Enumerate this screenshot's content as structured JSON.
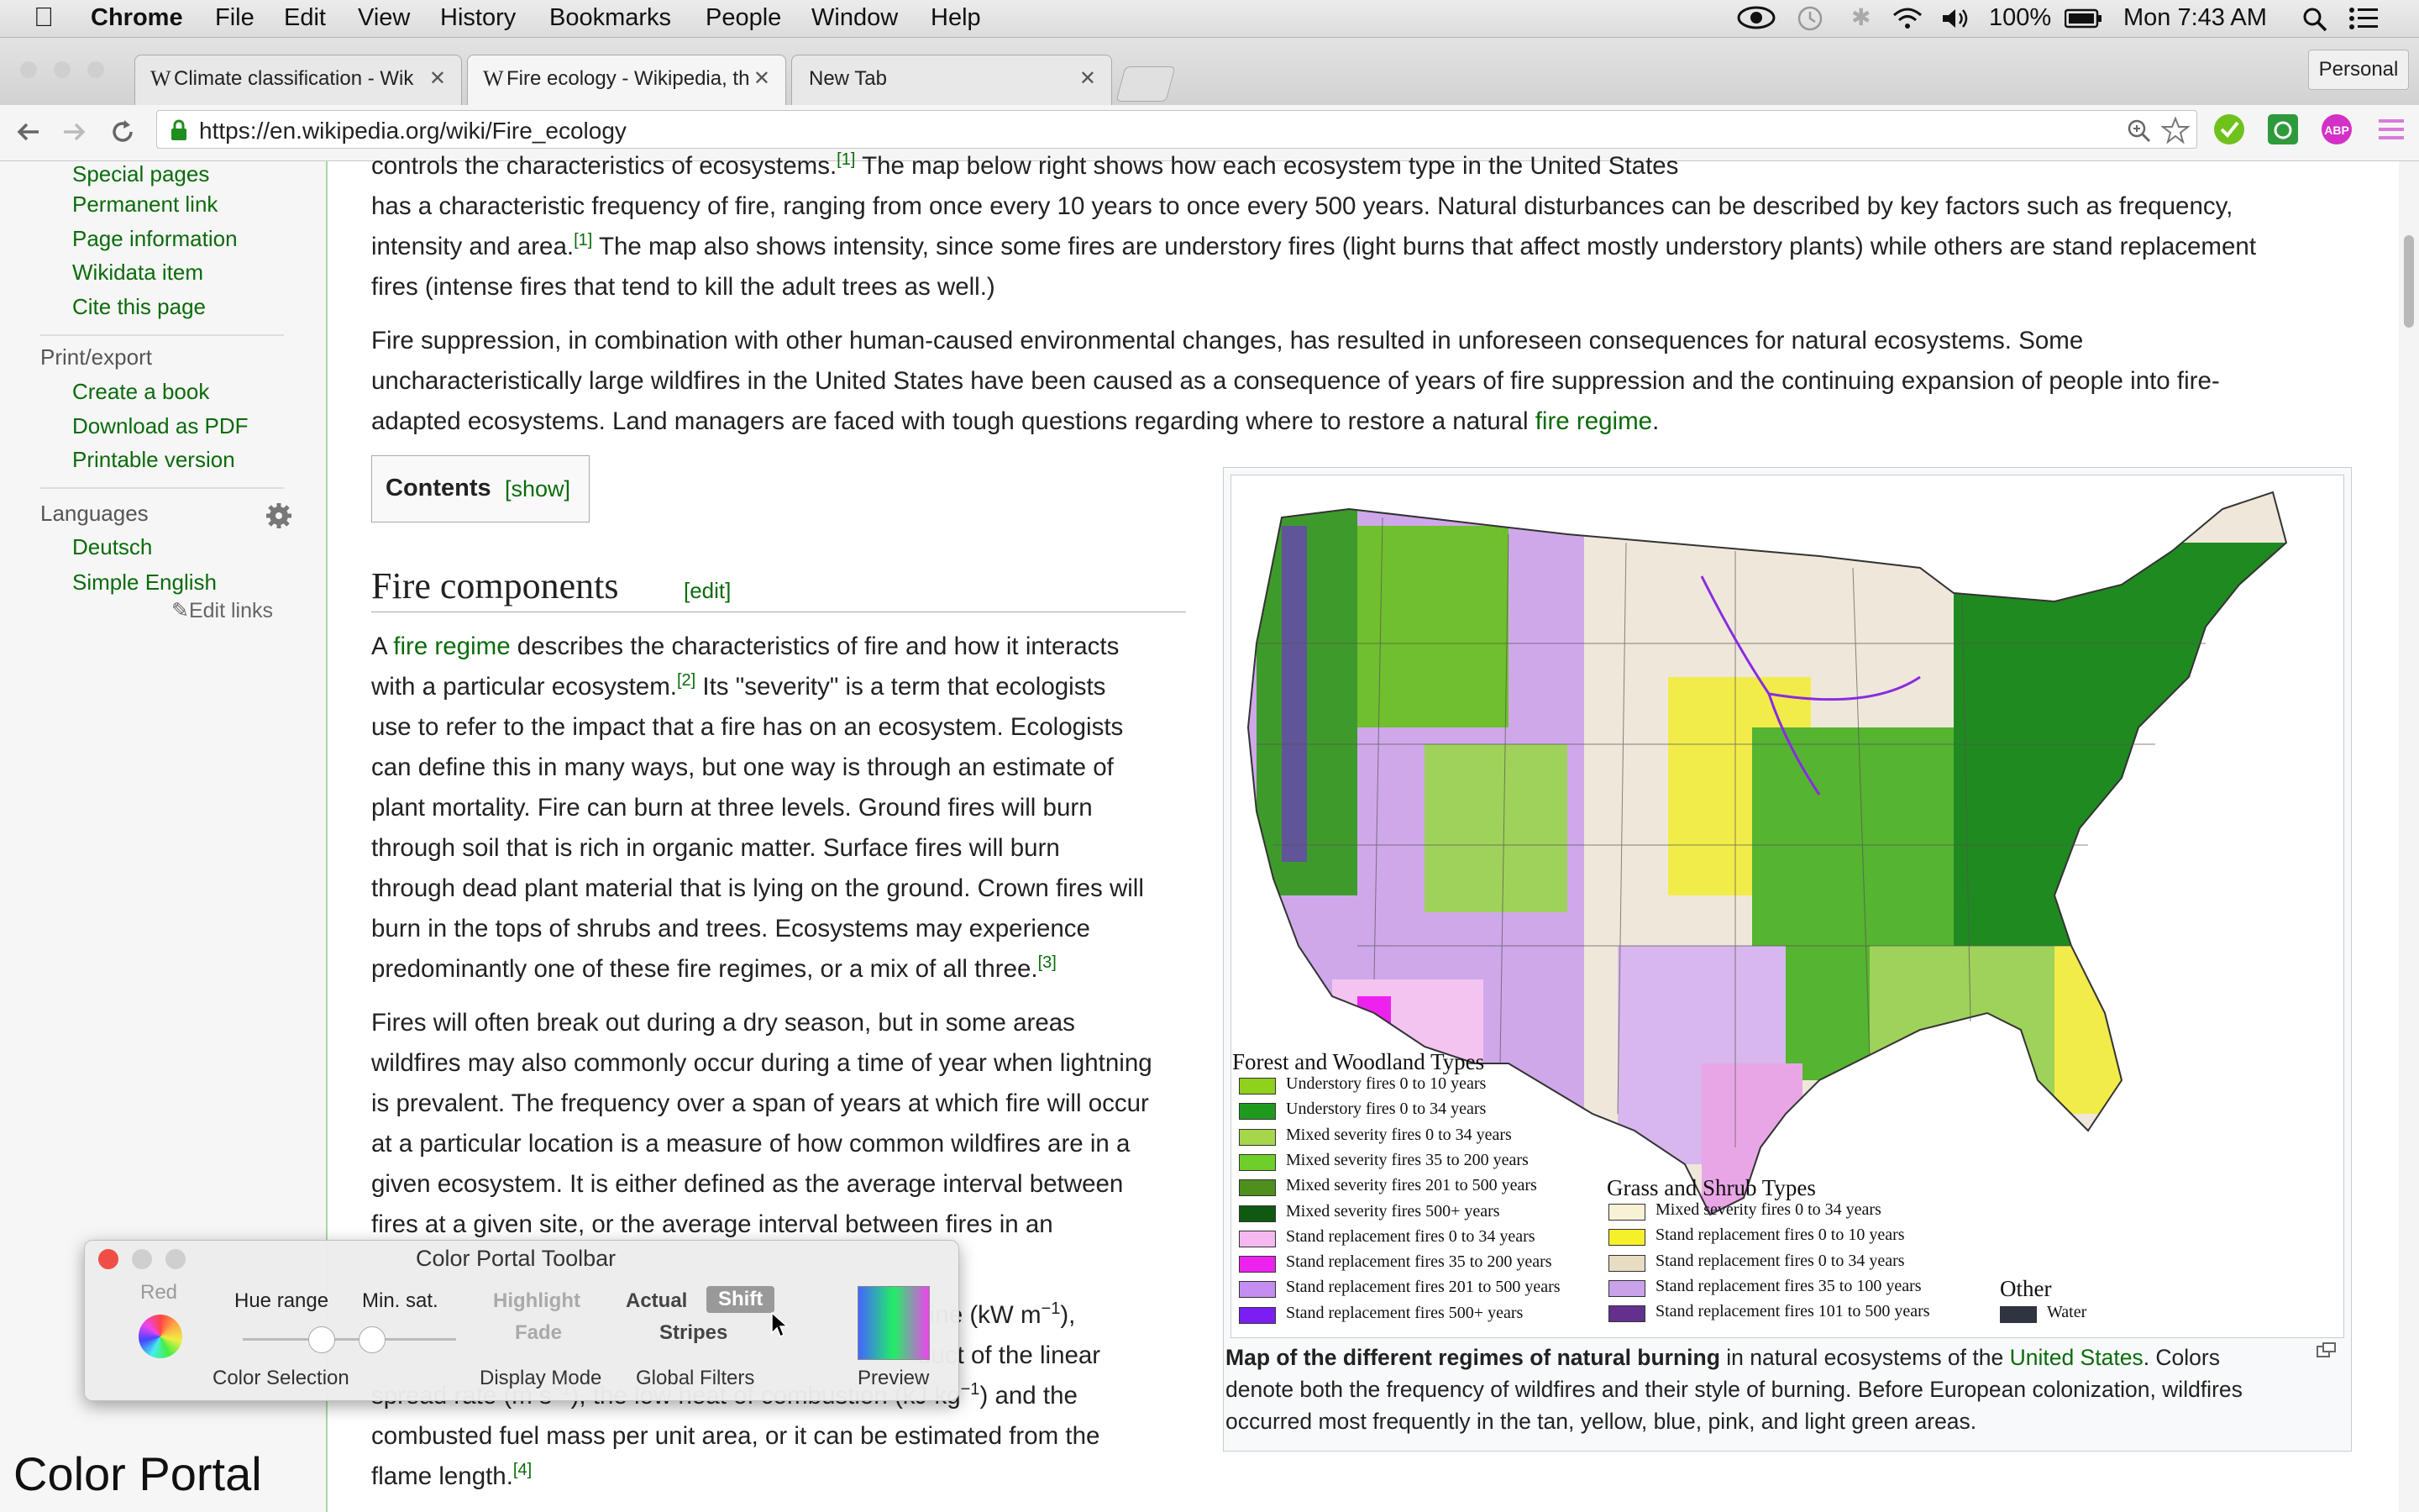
{
  "menubar": {
    "app": "Chrome",
    "items": [
      "File",
      "Edit",
      "View",
      "History",
      "Bookmarks",
      "People",
      "Window",
      "Help"
    ],
    "battery": "100%",
    "clock": "Mon 7:43 AM"
  },
  "tabs": [
    {
      "label": "Climate classification - Wik",
      "favicon": "W"
    },
    {
      "label": "Fire ecology - Wikipedia, th",
      "favicon": "W"
    },
    {
      "label": "New Tab",
      "favicon": ""
    }
  ],
  "profile": "Personal",
  "url": "https://en.wikipedia.org/wiki/Fire_ecology",
  "sidebar": {
    "tools": [
      "Special pages",
      "Permanent link",
      "Page information",
      "Wikidata item",
      "Cite this page"
    ],
    "print_heading": "Print/export",
    "print": [
      "Create a book",
      "Download as PDF",
      "Printable version"
    ],
    "lang_heading": "Languages",
    "languages": [
      "Deutsch",
      "Simple English"
    ],
    "edit_links": "Edit links"
  },
  "article": {
    "p0_line0": "controls the characteristics of ecosystems.",
    "p0_ref0": "[1]",
    "p0_line0b": " The map below right shows how each ecosystem type in the United States",
    "p0_line1": "has a characteristic frequency of fire, ranging from once every 10 years to once every 500 years. Natural disturbances can be described by key factors such as frequency,",
    "p0_line2a": "intensity and area.",
    "p0_ref1": "[1]",
    "p0_line2b": " The map also shows intensity, since some fires are understory fires (light burns that affect mostly understory plants) while others are stand replacement",
    "p0_line3": "fires (intense fires that tend to kill the adult trees as well.)",
    "p1_line0": "Fire suppression, in combination with other human-caused environmental changes, has resulted in unforeseen consequences for natural ecosystems. Some",
    "p1_line1": "uncharacteristically large wildfires in the United States have been caused as a consequence of years of fire suppression and the continuing expansion of people into fire-",
    "p1_line2a": "adapted ecosystems. Land managers are faced with tough questions regarding where to restore a natural ",
    "p1_link": "fire regime",
    "p1_line2b": ".",
    "toc_title": "Contents",
    "toc_show": "[show]",
    "section_title": "Fire components",
    "section_edit": "[edit]",
    "p2_a": "A ",
    "p2_link": "fire regime",
    "p2_lines": [
      " describes the characteristics of fire and how it interacts",
      "with a particular ecosystem.",
      "use to refer to the impact that a fire has on an ecosystem. Ecologists",
      "can define this in many ways, but one way is through an estimate of",
      "plant mortality. Fire can burn at three levels. Ground fires will burn",
      "through soil that is rich in organic matter. Surface fires will burn",
      "through dead plant material that is lying on the ground. Crown fires will",
      "burn in the tops of shrubs and trees. Ecosystems may experience",
      "predominantly one of these fire regimes, or a mix of all three."
    ],
    "p2_ref2": "[2]",
    "p2_line1b": " Its \"severity\" is a term that ecologists",
    "p2_ref3": "[3]",
    "p3_lines": [
      "Fires will often break out during a dry season, but in some areas",
      "wildfires may also commonly occur during a time of year when lightning",
      "is prevalent. The frequency over a span of years at which fire will occur",
      "at a particular location is a measure of how common wildfires are in a",
      "given ecosystem. It is either defined as the average interval between",
      "fires at a given site, or the average interval between fires in an"
    ],
    "p4_l0": "reline (kW m",
    "p4_l0_sup": "−1",
    "p4_l0_end": "),",
    "p4_l1": "duct of the linear",
    "p4_l2": "spread rate (m s",
    "p4_l2_sup": "−1",
    "p4_l2_b": "), the low heat of combustion (kJ kg",
    "p4_l2_sup2": "−1",
    "p4_l2_c": ") and the",
    "p4_l3": "combusted fuel mass per unit area, or it can be estimated from the",
    "p4_l4": "flame length.",
    "p4_ref4": "[4]"
  },
  "figure": {
    "forest_heading": "Forest and Woodland Types",
    "forest": [
      {
        "label": "Understory fires  0 to 10 years",
        "color": "#8fd11c"
      },
      {
        "label": "Understory fires  0 to 34 years",
        "color": "#1f9a1f"
      },
      {
        "label": "Mixed severity fires  0 to 34 years",
        "color": "#a6d64a"
      },
      {
        "label": "Mixed severity fires  35 to 200 years",
        "color": "#6fcf2a"
      },
      {
        "label": "Mixed severity fires  201 to 500 years",
        "color": "#4e8f1e"
      },
      {
        "label": "Mixed severity fires  500+ years",
        "color": "#0e5a12"
      },
      {
        "label": "Stand replacement fires  0 to 34 years",
        "color": "#f6b8f0"
      },
      {
        "label": "Stand replacement fires 35 to 200 years",
        "color": "#ee22ee"
      },
      {
        "label": "Stand replacement fires  201 to 500 years",
        "color": "#c48ef0"
      },
      {
        "label": "Stand replacement fires  500+ years",
        "color": "#7a1ef2"
      }
    ],
    "grass_heading": "Grass and Shrub Types",
    "grass": [
      {
        "label": "Mixed severity fires 0 to 34 years",
        "color": "#f7f1d6"
      },
      {
        "label": "Stand replacement fires  0 to 10 years",
        "color": "#f5f02a"
      },
      {
        "label": "Stand replacement fires  0 to 34 years",
        "color": "#e8dcc4"
      },
      {
        "label": "Stand replacement fires  35 to 100 years",
        "color": "#c9a2ea"
      },
      {
        "label": "Stand replacement fires  101 to 500 years",
        "color": "#64308e"
      }
    ],
    "other_heading": "Other",
    "other": [
      {
        "label": "Water",
        "color": "#2f3540"
      }
    ],
    "caption_bold": "Map of the different regimes of natural burning",
    "caption_a": " in natural ecosystems of the ",
    "caption_link": "United States",
    "caption_b": ". Colors",
    "caption_l2": "denote both the frequency of wildfires and their style of burning. Before European colonization, wildfires",
    "caption_l3": "occurred most frequently in the tan, yellow, blue, pink, and light green areas."
  },
  "portal": {
    "title": "Color Portal Toolbar",
    "red": "Red",
    "hue_range": "Hue range",
    "min_sat": "Min. sat.",
    "highlight": "Highlight",
    "fade": "Fade",
    "actual": "Actual",
    "shift": "Shift",
    "stripes": "Stripes",
    "color_selection": "Color Selection",
    "display_mode": "Display Mode",
    "global_filters": "Global Filters",
    "preview": "Preview",
    "watermark": "Color Portal"
  }
}
